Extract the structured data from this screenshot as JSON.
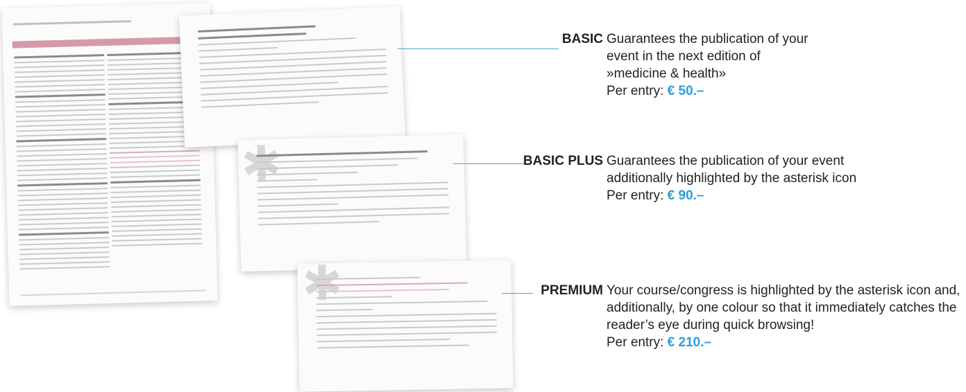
{
  "tiers": [
    {
      "name": "BASIC",
      "description": "Guarantees the publication of your event in the next edition of »medicine & health»",
      "price_prefix": "Per entry:",
      "price": "€ 50.–"
    },
    {
      "name": "BASIC PLUS",
      "description": "Guarantees the publication of your event additionally highlighted by the asterisk icon",
      "price_prefix": "Per entry:",
      "price": "€ 90.–"
    },
    {
      "name": "PREMIUM",
      "description": "Your course/congress is highlighted by the asterisk icon and, additionally, by one colour so that it immediately catches the reader’s eye during quick browsing!",
      "price_prefix": "Per entry:",
      "price": "€ 210.–"
    }
  ],
  "colors": {
    "accent": "#2a9fd8",
    "highlight": "#d59aa8"
  }
}
